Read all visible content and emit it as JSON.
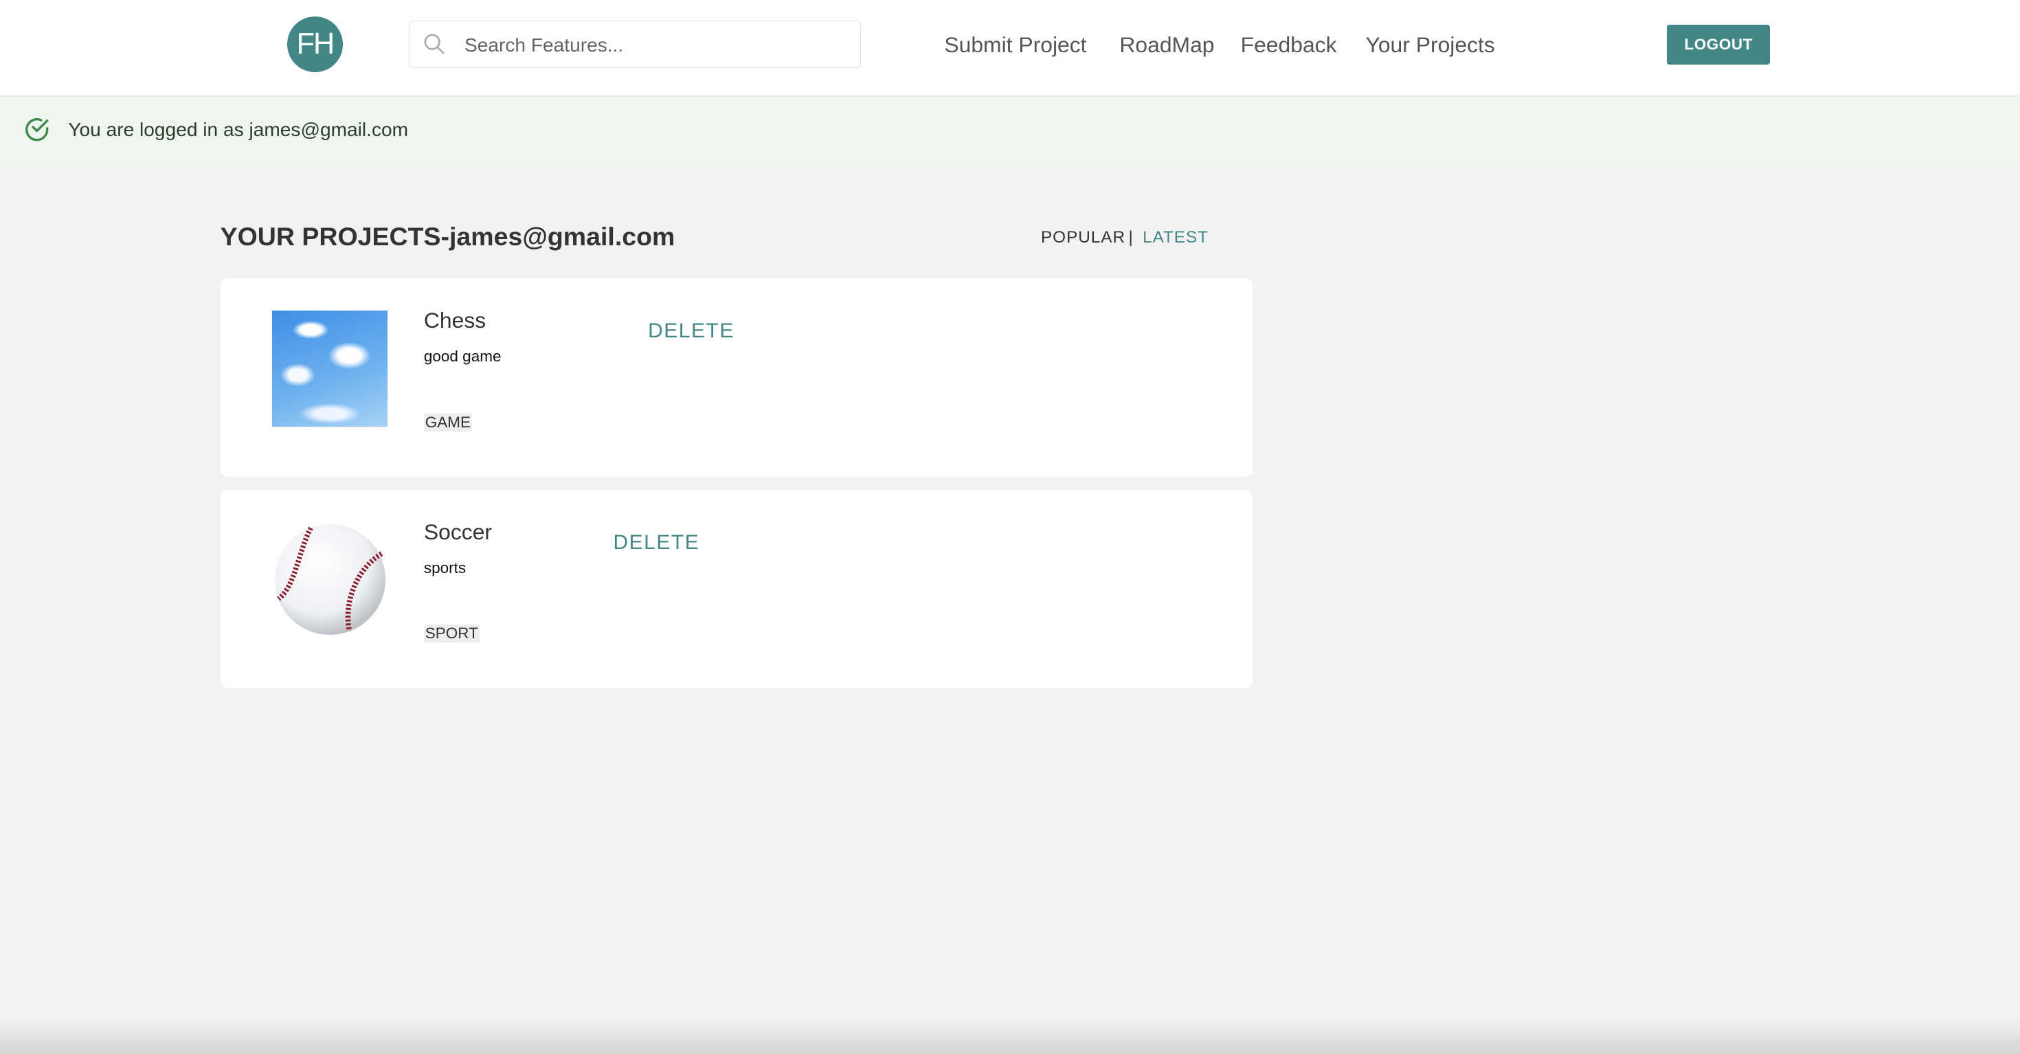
{
  "header": {
    "logo_text": "FH",
    "search_placeholder": "Search Features...",
    "nav": [
      "Submit Project",
      "RoadMap",
      "Feedback",
      "Your Projects"
    ],
    "logout_label": "LOGOUT"
  },
  "banner": {
    "text": "You are logged in as james@gmail.com"
  },
  "main": {
    "title": "YOUR PROJECTS-james@gmail.com",
    "sort": {
      "popular": "POPULAR",
      "separator": "|",
      "latest": "LATEST"
    },
    "projects": [
      {
        "title": "Chess",
        "description": "good game",
        "tag": "GAME",
        "delete_label": "DELETE"
      },
      {
        "title": "Soccer",
        "description": "sports",
        "tag": "SPORT",
        "delete_label": "DELETE"
      }
    ]
  },
  "colors": {
    "accent": "#438686",
    "banner_bg": "#eff5ef",
    "page_bg": "#f2f2f2"
  }
}
